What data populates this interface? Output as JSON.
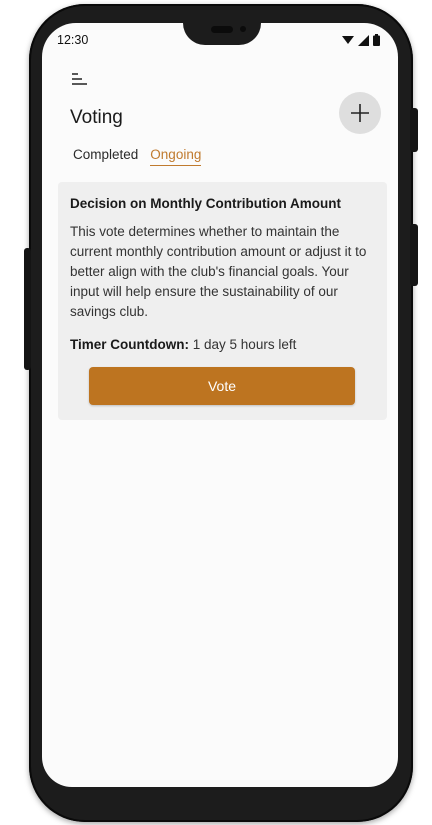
{
  "status_bar": {
    "time": "12:30",
    "icons": [
      "wifi-icon",
      "signal-icon",
      "battery-icon"
    ]
  },
  "header": {
    "menu_icon": "menu-icon",
    "title": "Voting",
    "add_icon": "plus-icon"
  },
  "tabs": [
    {
      "label": "Completed",
      "active": false
    },
    {
      "label": "Ongoing",
      "active": true
    }
  ],
  "vote_card": {
    "title": "Decision on Monthly Contribution Amount",
    "description": "This vote determines whether to maintain the current monthly contribution amount or adjust it to better align with the club's financial goals. Your input will help ensure the sustainability of our savings club.",
    "timer_label": "Timer Countdown:",
    "timer_value": "1 day 5 hours left",
    "vote_button_label": "Vote"
  },
  "colors": {
    "accent": "#c07a2e",
    "button": "#bd7420",
    "card_bg": "#efefef",
    "add_button_bg": "#dedede"
  }
}
